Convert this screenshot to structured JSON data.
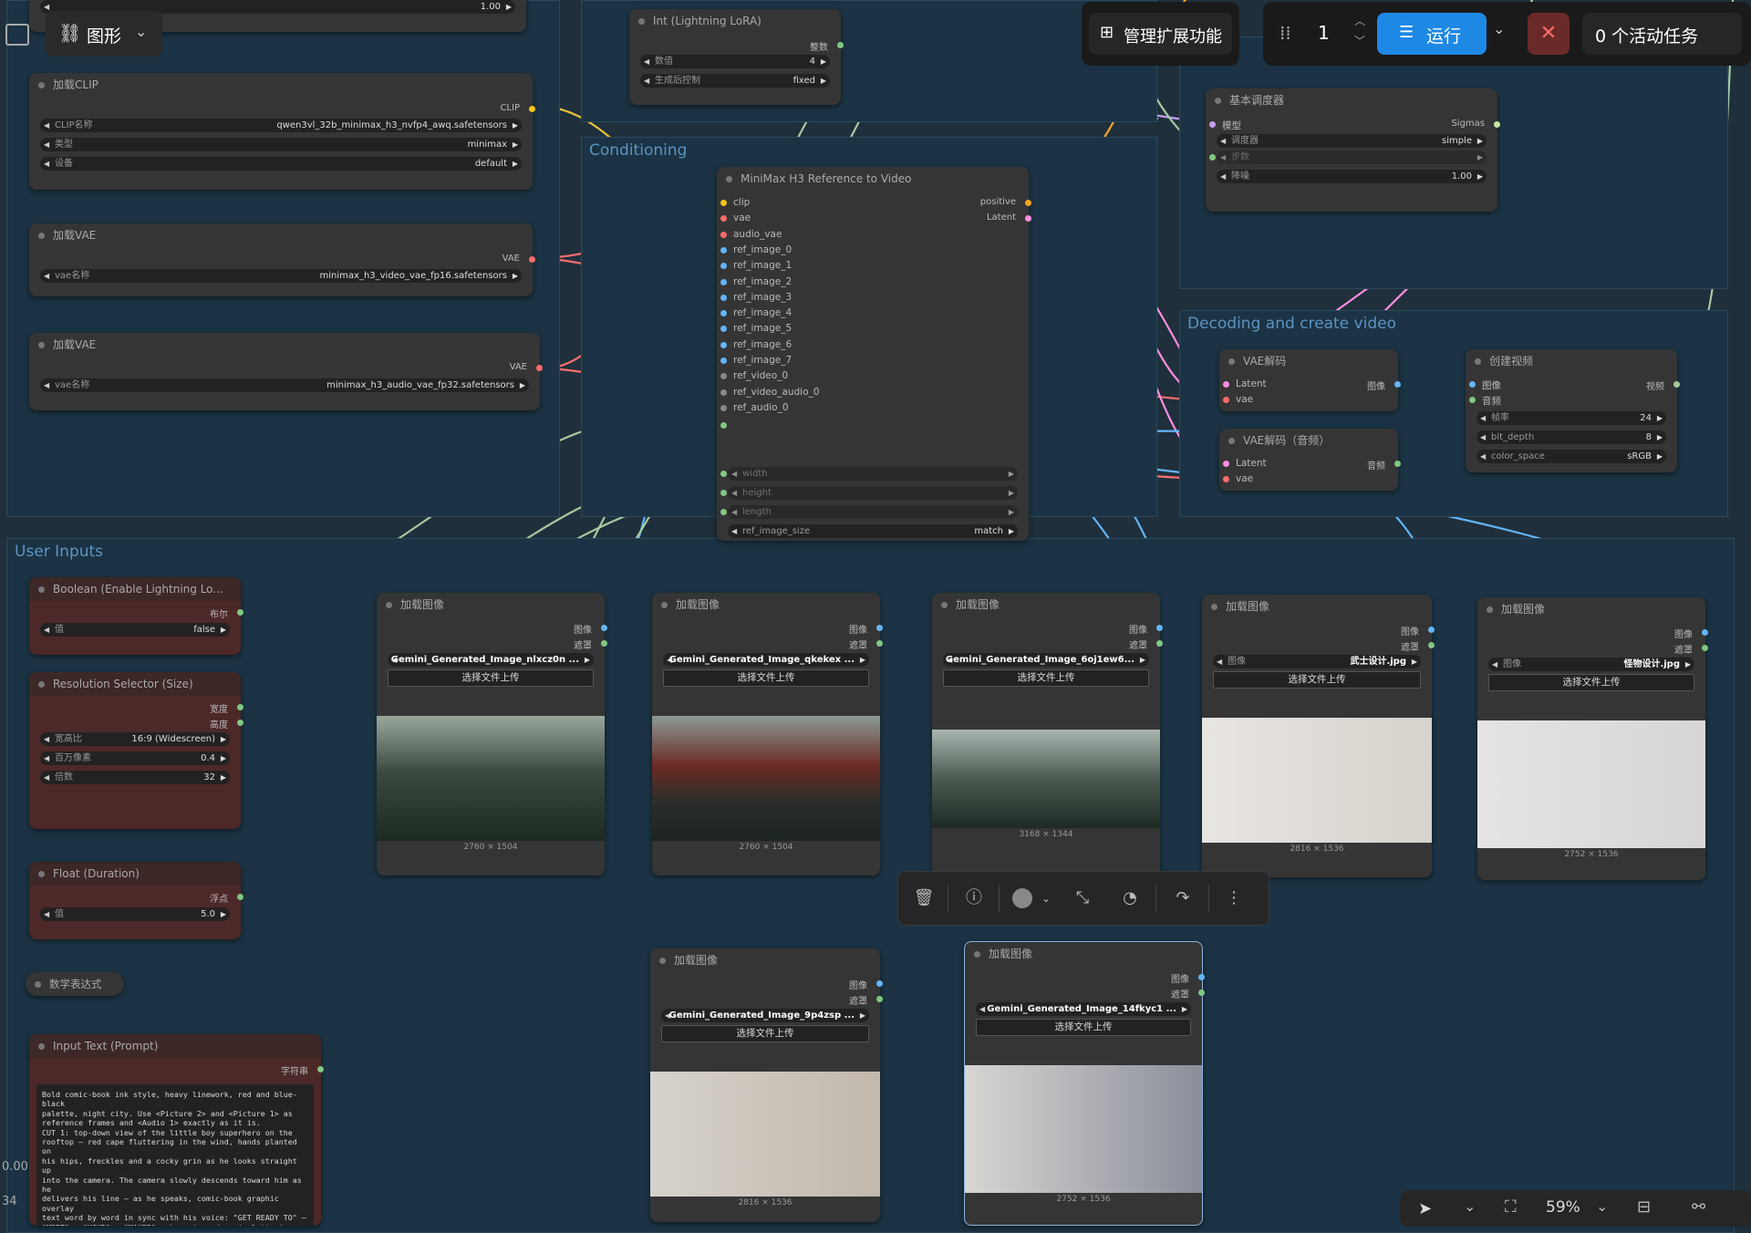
{
  "header": {
    "graph_label": "图形",
    "manage_extensions": "管理扩展功能",
    "queue_count": "1",
    "run_label": "运行",
    "active_tasks": "0 个活动任务"
  },
  "groups": {
    "conditioning": "Conditioning",
    "decoding": "Decoding and create video",
    "user_inputs": "User Inputs"
  },
  "top_partial": {
    "value": "1.00"
  },
  "int_lora": {
    "title": "Int (Lightning LoRA)",
    "out": "整数",
    "value_label": "数值",
    "value": "4",
    "ctrl_label": "生成后控制",
    "ctrl_value": "fixed"
  },
  "load_clip": {
    "title": "加载CLIP",
    "out": "CLIP",
    "w1l": "CLIP名称",
    "w1v": "qwen3vl_32b_minimax_h3_nvfp4_awq.safetensors",
    "w2l": "类型",
    "w2v": "minimax",
    "w3l": "设备",
    "w3v": "default"
  },
  "load_vae1": {
    "title": "加载VAE",
    "out": "VAE",
    "wl": "vae名称",
    "wv": "minimax_h3_video_vae_fp16.safetensors"
  },
  "load_vae2": {
    "title": "加载VAE",
    "out": "VAE",
    "wl": "vae名称",
    "wv": "minimax_h3_audio_vae_fp32.safetensors"
  },
  "ref_video": {
    "title": "MiniMax H3 Reference to Video",
    "inputs": [
      "clip",
      "vae",
      "audio_vae",
      "ref_image_0",
      "ref_image_1",
      "ref_image_2",
      "ref_image_3",
      "ref_image_4",
      "ref_image_5",
      "ref_image_6",
      "ref_image_7",
      "ref_video_0",
      "ref_video_audio_0",
      "ref_audio_0"
    ],
    "out_positive": "positive",
    "out_latent": "Latent",
    "w_width": "width",
    "w_height": "height",
    "w_length": "length",
    "size_label": "ref_image_size",
    "size_value": "match"
  },
  "scheduler": {
    "title": "基本调度器",
    "in_model": "模型",
    "out": "Sigmas",
    "w1l": "调度器",
    "w1v": "simple",
    "w2l": "步数",
    "w3l": "降噪",
    "w3v": "1.00"
  },
  "vae_decode": {
    "title": "VAE解码",
    "in1": "Latent",
    "in2": "vae",
    "out": "图像"
  },
  "vae_decode_audio": {
    "title": "VAE解码（音频）",
    "in1": "Latent",
    "in2": "vae",
    "out": "音频"
  },
  "create_video": {
    "title": "创建视频",
    "in1": "图像",
    "in2": "音频",
    "out": "视频",
    "w1l": "帧率",
    "w1v": "24",
    "w2l": "bit_depth",
    "w2v": "8",
    "w3l": "color_space",
    "w3v": "sRGB"
  },
  "boolean": {
    "title": "Boolean (Enable Lightning Lo...",
    "out": "布尔",
    "wl": "值",
    "wv": "false"
  },
  "resolution": {
    "title": "Resolution Selector (Size)",
    "out1": "宽度",
    "out2": "高度",
    "w1l": "宽高比",
    "w1v": "16:9 (Widescreen)",
    "w2l": "百万像素",
    "w2v": "0.4",
    "w3l": "倍数",
    "w3v": "32"
  },
  "float_duration": {
    "title": "Float (Duration)",
    "out": "浮点",
    "wl": "值",
    "wv": "5.0"
  },
  "math_expr": {
    "title": "数学表达式"
  },
  "input_text": {
    "title": "Input Text (Prompt)",
    "out": "字符串",
    "text": "Bold comic-book ink style, heavy linework, red and blue-black\npalette, night city. Use <Picture 2> and <Picture 1> as\nreference frames and <Audio 1> exactly as it is.\nCUT 1: top-down view of the little boy superhero on the\nrooftop — red cape fluttering in the wind, hands planted on\nhis hips, freckles and a cocky grin as he looks straight up\ninto the camera. The camera slowly descends toward him as he\ndelivers his line — as he speaks, comic-book graphic overlay\ntext word by word in sync with his voice: \"GET READY TO\" —\n\"MEET\" — \"YOUR\" — \"MAKER\" — huge jagged comic lettering, white\nwith heavy black outlines and red drop shadows, tilted at\nscrappy angles, until the three words hang stacked in the air\nabove him between his face and the lens.\nTRANSITION: a violent WHIP PAN off the rooftop that SMEARS the"
  },
  "load_images": [
    {
      "title": "加载图像",
      "out1": "图像",
      "out2": "遮罩",
      "file": "Gemini_Generated_Image_nlxcz0n ...",
      "upload": "选择文件上传",
      "dim": "2760 × 1504"
    },
    {
      "title": "加载图像",
      "out1": "图像",
      "out2": "遮罩",
      "file": "Gemini_Generated_Image_qkekex ...",
      "upload": "选择文件上传",
      "dim": "2760 × 1504"
    },
    {
      "title": "加载图像",
      "out1": "图像",
      "out2": "遮罩",
      "file": "Gemini_Generated_Image_6oj1ew6...",
      "upload": "选择文件上传",
      "dim": "3168 × 1344"
    },
    {
      "title": "加载图像",
      "out1": "图像",
      "out2": "遮罩",
      "file_label": "图像",
      "file": "武士设计.jpg",
      "upload": "选择文件上传",
      "dim": "2816 × 1536"
    },
    {
      "title": "加载图像",
      "out1": "图像",
      "out2": "遮罩",
      "file_label": "图像",
      "file": "怪物设计.jpg",
      "upload": "选择文件上传",
      "dim": "2752 × 1536"
    },
    {
      "title": "加载图像",
      "out1": "图像",
      "out2": "遮罩",
      "file": "Gemini_Generated_Image_9p4zsp ...",
      "upload": "选择文件上传",
      "dim": "2816 × 1536"
    },
    {
      "title": "加载图像",
      "out1": "图像",
      "out2": "遮罩",
      "file": "Gemini_Generated_Image_14fkyc1 ...",
      "upload": "选择文件上传",
      "dim": "2752 × 1536"
    }
  ],
  "bottom_right": {
    "zoom": "59%"
  },
  "left_edge": {
    "v1": "0.00",
    "v2": "34"
  },
  "colors": {
    "clip": "#f5c518",
    "vae": "#ff6b6b",
    "image": "#64b5f6",
    "mask": "#81c784",
    "latent": "#ff8ee0"
  }
}
